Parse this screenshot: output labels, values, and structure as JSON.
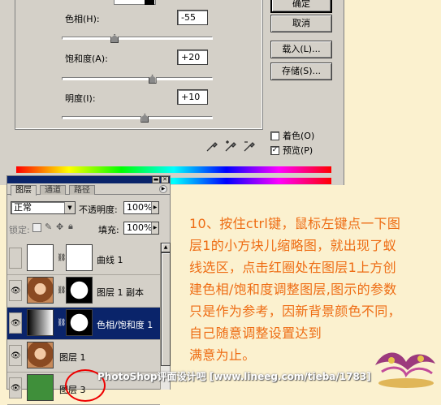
{
  "dialog": {
    "hue": {
      "label": "色相(H):",
      "value": "-55",
      "slider": 0.35
    },
    "saturation": {
      "label": "饱和度(A):",
      "value": "+20",
      "slider": 0.6
    },
    "lightness": {
      "label": "明度(I):",
      "value": "+10",
      "slider": 0.55
    },
    "buttons": {
      "ok": "确定",
      "cancel": "取消",
      "load": "载入(L)...",
      "save": "存储(S)..."
    },
    "colorize": {
      "label": "着色(O)",
      "checked": false
    },
    "preview": {
      "label": "预览(P)",
      "checked": true
    }
  },
  "layers_panel": {
    "tabs": [
      "图层",
      "通道",
      "路径"
    ],
    "blend_mode": "正常",
    "opacity_label": "不透明度:",
    "opacity_value": "100%",
    "lock_label": "锁定:",
    "fill_label": "填充:",
    "fill_value": "100%",
    "layers": [
      {
        "name": "曲线 1",
        "visible": false,
        "selected": false
      },
      {
        "name": "图层 1 副本",
        "visible": true,
        "selected": false
      },
      {
        "name": "色相/饱和度 1",
        "visible": true,
        "selected": true
      },
      {
        "name": "图层 1",
        "visible": true,
        "selected": false
      },
      {
        "name": "图层 3",
        "visible": true,
        "selected": false
      }
    ]
  },
  "tutorial": {
    "lines": [
      "10、按住ctrl键，鼠标左键点一下图",
      "层1的小方块儿缩略图，就出现了蚁",
      "线选区，点击红圈处在图层1上方创",
      "建色相/饱和度调整图层,图示的参数",
      "只是作为参考，因新背景颜色不同，",
      "自己随意调整设置达到",
      "满意为止。"
    ]
  },
  "watermark": "PhotoShop评面设计吧 [www.lineeg.com/tieba/1783]",
  "colors": {
    "accent_text": "#ee6c13",
    "selection": "#0a246a"
  }
}
